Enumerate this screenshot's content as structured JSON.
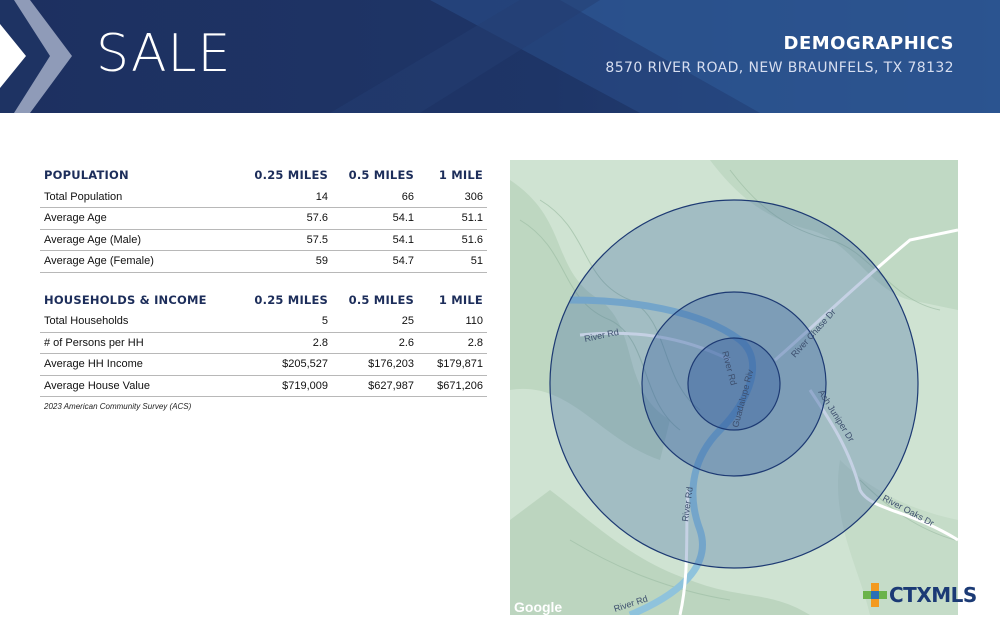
{
  "header": {
    "title": "SALE",
    "section_title": "DEMOGRAPHICS",
    "address": "8570 RIVER ROAD, NEW BRAUNFELS, TX 78132"
  },
  "population_table": {
    "headers": [
      "POPULATION",
      "0.25 MILES",
      "0.5 MILES",
      "1 MILE"
    ],
    "rows": [
      [
        "Total Population",
        "14",
        "66",
        "306"
      ],
      [
        "Average Age",
        "57.6",
        "54.1",
        "51.1"
      ],
      [
        "Average Age (Male)",
        "57.5",
        "54.1",
        "51.6"
      ],
      [
        "Average Age (Female)",
        "59",
        "54.7",
        "51"
      ]
    ]
  },
  "households_table": {
    "headers": [
      "HOUSEHOLDS & INCOME",
      "0.25 MILES",
      "0.5 MILES",
      "1 MILE"
    ],
    "rows": [
      [
        "Total Households",
        "5",
        "25",
        "110"
      ],
      [
        "# of Persons per HH",
        "2.8",
        "2.6",
        "2.8"
      ],
      [
        "Average HH Income",
        "$205,527",
        "$176,203",
        "$179,871"
      ],
      [
        "Average House Value",
        "$719,009",
        "$627,987",
        "$671,206"
      ]
    ]
  },
  "source_note": "2023 American Community Survey (ACS)",
  "map": {
    "road_labels": {
      "river_rd_top": "River Rd",
      "river_rd_vertical": "River Rd",
      "river_rd_center": "River Rd",
      "guadalupe": "Guadalupe Riv",
      "river_chase": "River Chase Dr",
      "ash_juniper": "Ash Juniper Dr",
      "river_oaks": "River Oaks Dr",
      "river_rd_bottom": "River Rd"
    },
    "attribution": "Google",
    "colors": {
      "terrain": "#cfe3d2",
      "river": "#8fc3dc",
      "ring_fill": "#2f5a9e",
      "ring_stroke": "#1d3a73"
    }
  },
  "logo": {
    "text": "CTXMLS"
  }
}
